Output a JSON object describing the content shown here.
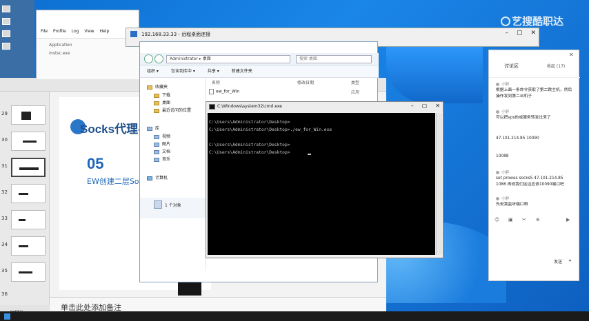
{
  "desktop": {
    "icons": [
      "",
      "",
      "",
      ""
    ]
  },
  "taskwin": {
    "menu": [
      "File",
      "Profile",
      "Log",
      "View",
      "Help"
    ],
    "lines": [
      "Application",
      "mstsc.exe"
    ]
  },
  "rdp": {
    "title": "192.168.33.33 - 远程桌面连接"
  },
  "explorer": {
    "path": "Administrator ▸ 桌面",
    "search": "搜索 桌面",
    "toolbar": [
      "组织 ▾",
      "包含到库中 ▾",
      "共享 ▾",
      "新建文件夹"
    ],
    "nav": [
      {
        "label": "收藏夹",
        "icon": "star-icon"
      },
      {
        "label": "下载",
        "icon": "folder-icon"
      },
      {
        "label": "桌面",
        "icon": "folder-icon"
      },
      {
        "label": "最近访问的位置",
        "icon": "folder-icon"
      },
      {
        "label": "库",
        "icon": "library-icon"
      },
      {
        "label": "视频",
        "icon": "library-icon"
      },
      {
        "label": "图片",
        "icon": "library-icon"
      },
      {
        "label": "文档",
        "icon": "library-icon"
      },
      {
        "label": "音乐",
        "icon": "library-icon"
      },
      {
        "label": "计算机",
        "icon": "computer-icon"
      }
    ],
    "columns": [
      "名称",
      "修改日期",
      "类型"
    ],
    "file": {
      "name": "ew_for_Win",
      "date": "",
      "type": "应用"
    },
    "status": "1 个对象"
  },
  "cmd": {
    "title": "C:\\Windows\\system32\\cmd.exe",
    "lines": [
      "C:\\Users\\Administrator\\Desktop>",
      "C:\\Users\\Administrator\\Desktop>./ew_for_Win.exe",
      "",
      "C:\\Users\\Administrator\\Desktop>",
      "C:\\Users\\Administrator\\Desktop>"
    ]
  },
  "ppt": {
    "slide_numbers": [
      "29",
      "30",
      "31",
      "32",
      "33",
      "34",
      "35",
      "36"
    ],
    "slide_title": "Socks代理-I",
    "slide_number": "05",
    "slide_subtitle": "EW创建二层Soc",
    "notes_placeholder": "单击此处添加备注",
    "status": "幻灯片"
  },
  "chat": {
    "title": "讨论区",
    "count": "收起 (17)",
    "messages": [
      {
        "user": "小胖",
        "text": "根据上面一条命令获取了第二跳主机，然后操作发到第二台机子"
      },
      {
        "user": "小胖",
        "text": "可以把vps的成服务转发过来了"
      },
      {
        "user": "",
        "text": "47.101.214.85 10090"
      },
      {
        "user": "",
        "text": "10088"
      },
      {
        "user": "小胖",
        "text": "set proxies socks5 47.101.214.85 1086 再说我们这边应该10090端口吧"
      },
      {
        "user": "小胖",
        "text": "先说我监听端口啊"
      }
    ],
    "send_label": "发送"
  },
  "watermark": "艺搜酷职达"
}
